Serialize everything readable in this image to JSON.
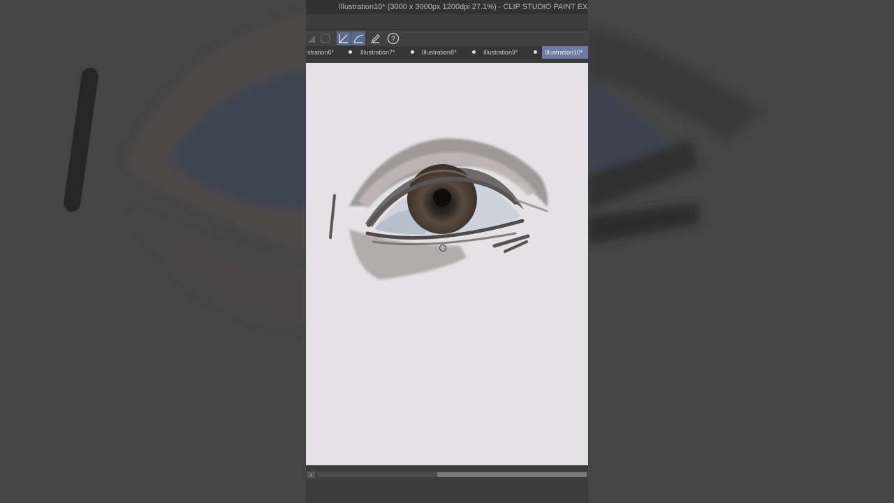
{
  "window": {
    "title": "Illustration10* (3000 x 3000px 1200dpi 27.1%)  - CLIP STUDIO PAINT EX"
  },
  "toolbar": {
    "icons": [
      "correction-icon",
      "square-icon",
      "stabilization-icon",
      "curve-icon",
      "pen-icon",
      "help-icon"
    ]
  },
  "tabs": [
    {
      "label": "stration6*"
    },
    {
      "label": "Illustration7*"
    },
    {
      "label": "Illustration8*"
    },
    {
      "label": "Illustration9*"
    },
    {
      "label": "Illustration10*"
    }
  ],
  "colors": {
    "accent": "#6d7ba3",
    "canvas_paper": "#e4e2e4",
    "background": "#454545"
  },
  "scrollbar": {
    "left_arrow": "‹"
  }
}
